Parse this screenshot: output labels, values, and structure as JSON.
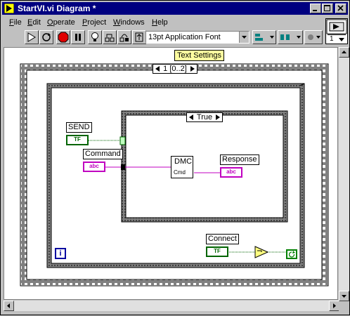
{
  "window": {
    "title": "StartVI.vi Diagram *"
  },
  "menubar": {
    "items": [
      {
        "label": "File",
        "key": "F",
        "rest": "ile"
      },
      {
        "label": "Edit",
        "key": "E",
        "rest": "dit"
      },
      {
        "label": "Operate",
        "key": "O",
        "rest": "perate"
      },
      {
        "label": "Project",
        "key": "P",
        "rest": "roject"
      },
      {
        "label": "Windows",
        "key": "W",
        "rest": "indows"
      },
      {
        "label": "Help",
        "key": "H",
        "rest": "elp"
      }
    ]
  },
  "toolbar": {
    "font": "13pt Application Font"
  },
  "vi_icon": {
    "label": "1"
  },
  "diagram": {
    "text_settings_tip": "Text Settings",
    "sequence_selector": "1 [0..2]",
    "case_selector": "True",
    "labels": {
      "send": "SEND",
      "command": "Command",
      "response": "Response",
      "connect": "Connect"
    },
    "terminals": {
      "tf": "TF",
      "abc": "abc"
    },
    "subvi": {
      "name": "DMC",
      "sub": "Cmd"
    },
    "iteration": "i"
  },
  "colors": {
    "title_bg": "#000080",
    "boolean_wire": "#006400",
    "string_wire": "#c000c0",
    "tip_bg": "#ffffa0"
  }
}
